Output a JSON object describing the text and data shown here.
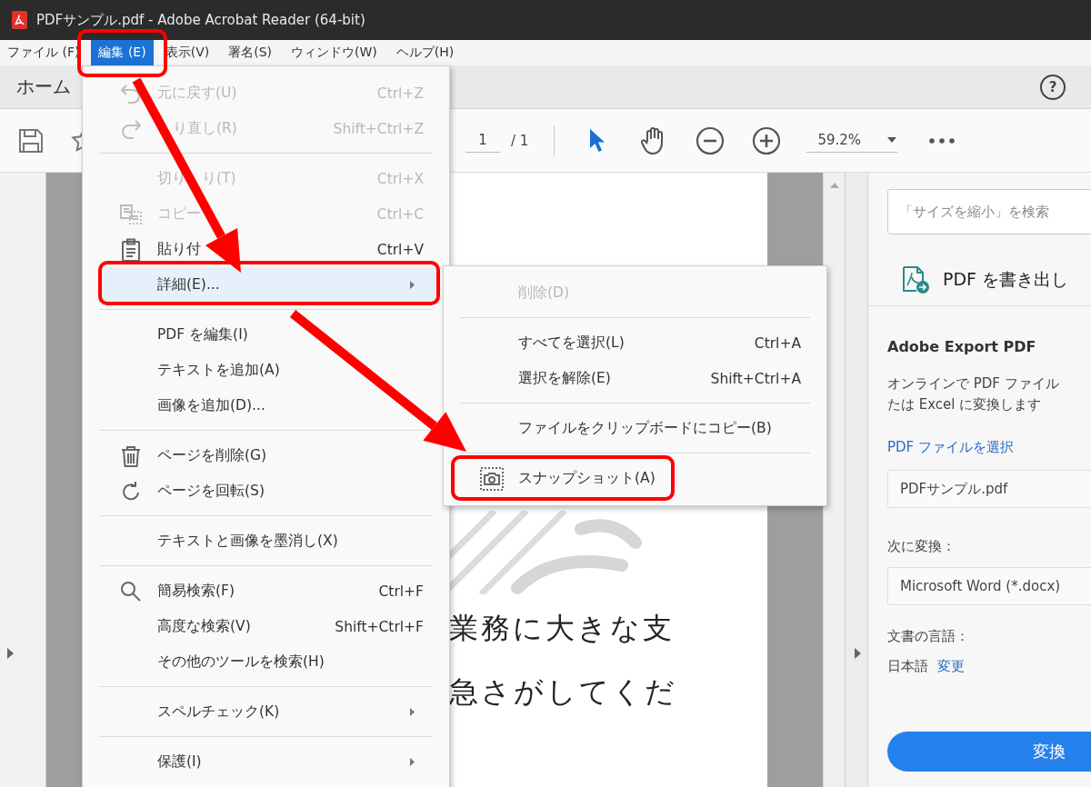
{
  "window": {
    "title": "PDFサンプル.pdf - Adobe Acrobat Reader (64-bit)"
  },
  "menu_bar": [
    {
      "label": "ファイル (F)",
      "selected": false
    },
    {
      "label": "編集 (E)",
      "selected": true
    },
    {
      "label": "表示(V)",
      "selected": false
    },
    {
      "label": "署名(S)",
      "selected": false
    },
    {
      "label": "ウィンドウ(W)",
      "selected": false
    },
    {
      "label": "ヘルプ(H)",
      "selected": false
    }
  ],
  "home_tab": {
    "label": "ホーム"
  },
  "help_button": {
    "label": "?"
  },
  "toolbar": {
    "page_number": "1",
    "page_count": "/ 1",
    "zoom": "59.2%"
  },
  "edit_menu": {
    "items": [
      {
        "kind": "item",
        "label": "元に戻す(U)",
        "shortcut": "Ctrl+Z",
        "disabled": true,
        "selected": false,
        "submenu": false
      },
      {
        "kind": "item",
        "label_parts": [
          "り直し(R)"
        ],
        "starts_covered": true,
        "shortcut": "Shift+Ctrl+Z",
        "disabled": true,
        "selected": false,
        "submenu": false
      },
      {
        "kind": "separator"
      },
      {
        "kind": "item",
        "label_parts": [
          "切り",
          "り(T)"
        ],
        "starts_covered": false,
        "shortcut": "Ctrl+X",
        "disabled": true,
        "selected": false,
        "submenu": false
      },
      {
        "kind": "item",
        "label": "コピー",
        "shortcut": "Ctrl+C",
        "disabled": true,
        "selected": false,
        "submenu": false
      },
      {
        "kind": "item",
        "label": "貼り付",
        "shortcut": "Ctrl+V",
        "disabled": false,
        "selected": false,
        "submenu": false
      },
      {
        "kind": "item",
        "label": "詳細(E)...",
        "disabled": false,
        "selected": true,
        "submenu": true
      },
      {
        "kind": "separator"
      },
      {
        "kind": "item",
        "label": "PDF を編集(I)",
        "disabled": false,
        "selected": false,
        "submenu": false
      },
      {
        "kind": "item",
        "label": "テキストを追加(A)",
        "disabled": false,
        "selected": false,
        "submenu": false
      },
      {
        "kind": "item",
        "label": "画像を追加(D)...",
        "disabled": false,
        "selected": false,
        "submenu": false
      },
      {
        "kind": "separator"
      },
      {
        "kind": "item",
        "label": "ページを削除(G)",
        "disabled": false,
        "selected": false,
        "submenu": false
      },
      {
        "kind": "item",
        "label": "ページを回転(S)",
        "disabled": false,
        "selected": false,
        "submenu": false
      },
      {
        "kind": "separator"
      },
      {
        "kind": "item",
        "label": "テキストと画像を墨消し(X)",
        "disabled": false,
        "selected": false,
        "submenu": false
      },
      {
        "kind": "separator"
      },
      {
        "kind": "item",
        "label": "簡易検索(F)",
        "shortcut": "Ctrl+F",
        "disabled": false,
        "selected": false,
        "submenu": false
      },
      {
        "kind": "item",
        "label": "高度な検索(V)",
        "shortcut": "Shift+Ctrl+F",
        "disabled": false,
        "selected": false,
        "submenu": false
      },
      {
        "kind": "item",
        "label": "その他のツールを検索(H)",
        "disabled": false,
        "selected": false,
        "submenu": false
      },
      {
        "kind": "separator"
      },
      {
        "kind": "item",
        "label": "スペルチェック(K)",
        "disabled": false,
        "selected": false,
        "submenu": true
      },
      {
        "kind": "separator"
      },
      {
        "kind": "item",
        "label": "保護(I)",
        "disabled": false,
        "selected": false,
        "submenu": true
      }
    ]
  },
  "submenu": {
    "items": [
      {
        "kind": "item",
        "label": "削除(D)",
        "disabled": true,
        "selected": false,
        "submenu": false
      },
      {
        "kind": "separator"
      },
      {
        "kind": "item",
        "label": "すべてを選択(L)",
        "shortcut": "Ctrl+A",
        "disabled": false,
        "selected": false,
        "submenu": false
      },
      {
        "kind": "item",
        "label": "選択を解除(E)",
        "shortcut": "Shift+Ctrl+A",
        "disabled": false,
        "selected": false,
        "submenu": false
      },
      {
        "kind": "separator"
      },
      {
        "kind": "item",
        "label": "ファイルをクリップボードにコピー(B)",
        "disabled": false,
        "selected": false,
        "submenu": false
      },
      {
        "kind": "separator"
      },
      {
        "kind": "item",
        "label": "スナップショット(A)",
        "disabled": false,
        "selected": false,
        "submenu": false
      }
    ]
  },
  "document": {
    "lines": [
      "業務に大きな支",
      "急さがしてくだ"
    ]
  },
  "right_panel": {
    "search": {
      "placeholder": "「サイズを縮小」を検索"
    },
    "tool": {
      "title": "PDF を書き出し"
    },
    "heading": "Adobe Export PDF",
    "description": [
      "オンラインで PDF ファイル",
      "たは Excel に変換します"
    ],
    "select_file_link": "PDF ファイルを選択",
    "file": {
      "value": "PDFサンプル.pdf"
    },
    "convert_label": "次に変換：",
    "format": {
      "value": "Microsoft Word (*.docx)"
    },
    "language_label": "文書の言語：",
    "language": "日本語",
    "change_link": "変更",
    "convert_button": "変換"
  }
}
